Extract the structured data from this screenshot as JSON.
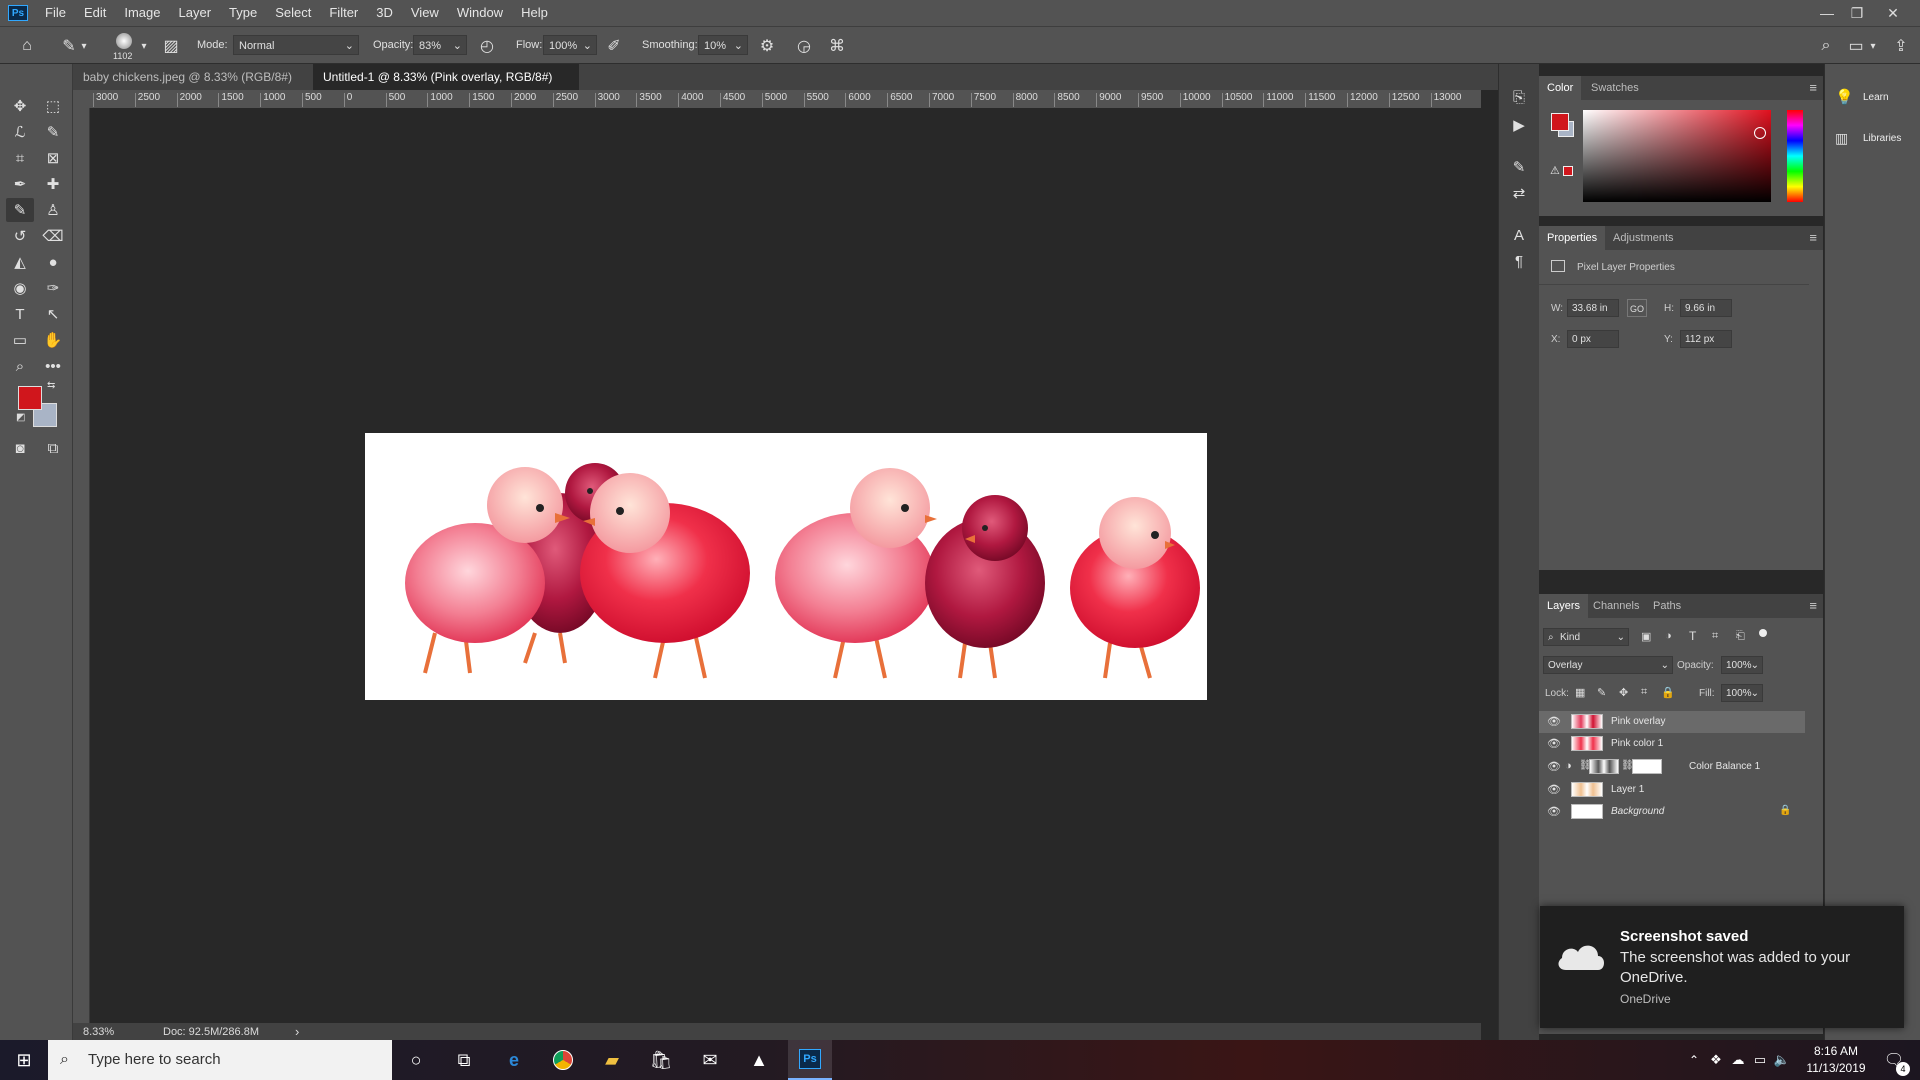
{
  "app": {
    "logo": "Ps",
    "menu": [
      "File",
      "Edit",
      "Image",
      "Layer",
      "Type",
      "Select",
      "Filter",
      "3D",
      "View",
      "Window",
      "Help"
    ]
  },
  "options": {
    "brush_size": "1102",
    "mode_label": "Mode:",
    "mode_value": "Normal",
    "opacity_label": "Opacity:",
    "opacity_value": "83%",
    "flow_label": "Flow:",
    "flow_value": "100%",
    "smoothing_label": "Smoothing:",
    "smoothing_value": "10%"
  },
  "tabs": [
    {
      "label": "baby chickens.jpeg @ 8.33% (RGB/8#) *"
    },
    {
      "label": "Untitled-1 @ 8.33% (Pink overlay, RGB/8#) *"
    }
  ],
  "ruler": {
    "h_ticks": [
      "3000",
      "2500",
      "2000",
      "1500",
      "1000",
      "500",
      "0",
      "500",
      "1000",
      "1500",
      "2000",
      "2500",
      "3000",
      "3500",
      "4000",
      "4500",
      "5000",
      "5500",
      "6000",
      "6500",
      "7000",
      "7500",
      "8000",
      "8500",
      "9000",
      "9500",
      "10000",
      "10500",
      "11000",
      "11500",
      "12000",
      "12500",
      "13000"
    ]
  },
  "status": {
    "zoom": "8.33%",
    "doc": "Doc: 92.5M/286.8M",
    "arrow": "›"
  },
  "color_panel": {
    "tabs": [
      "Color",
      "Swatches"
    ],
    "fg_color": "#d0161c",
    "bg_color": "#a9b4c6"
  },
  "properties_panel": {
    "tabs": [
      "Properties",
      "Adjustments"
    ],
    "title": "Pixel Layer Properties",
    "w_label": "W:",
    "w_value": "33.68 in",
    "link": "GO",
    "h_label": "H:",
    "h_value": "9.66 in",
    "x_label": "X:",
    "x_value": "0 px",
    "y_label": "Y:",
    "y_value": "112 px"
  },
  "layers_panel": {
    "tabs": [
      "Layers",
      "Channels",
      "Paths"
    ],
    "filter_value": "Kind",
    "blend_mode": "Overlay",
    "opacity_label": "Opacity:",
    "opacity_value": "100%",
    "lock_label": "Lock:",
    "fill_label": "Fill:",
    "fill_value": "100%",
    "layers": [
      {
        "name": "Pink overlay"
      },
      {
        "name": "Pink color 1"
      },
      {
        "name": "Color Balance 1"
      },
      {
        "name": "Layer 1"
      },
      {
        "name": "Background"
      }
    ]
  },
  "far_right": {
    "learn": "Learn",
    "libraries": "Libraries"
  },
  "toast": {
    "title": "Screenshot saved",
    "body": "The screenshot was added to your OneDrive.",
    "source": "OneDrive"
  },
  "taskbar": {
    "search_placeholder": "Type here to search",
    "time": "8:16 AM",
    "date": "11/13/2019",
    "notif_count": "4",
    "ps_label": "Ps"
  }
}
